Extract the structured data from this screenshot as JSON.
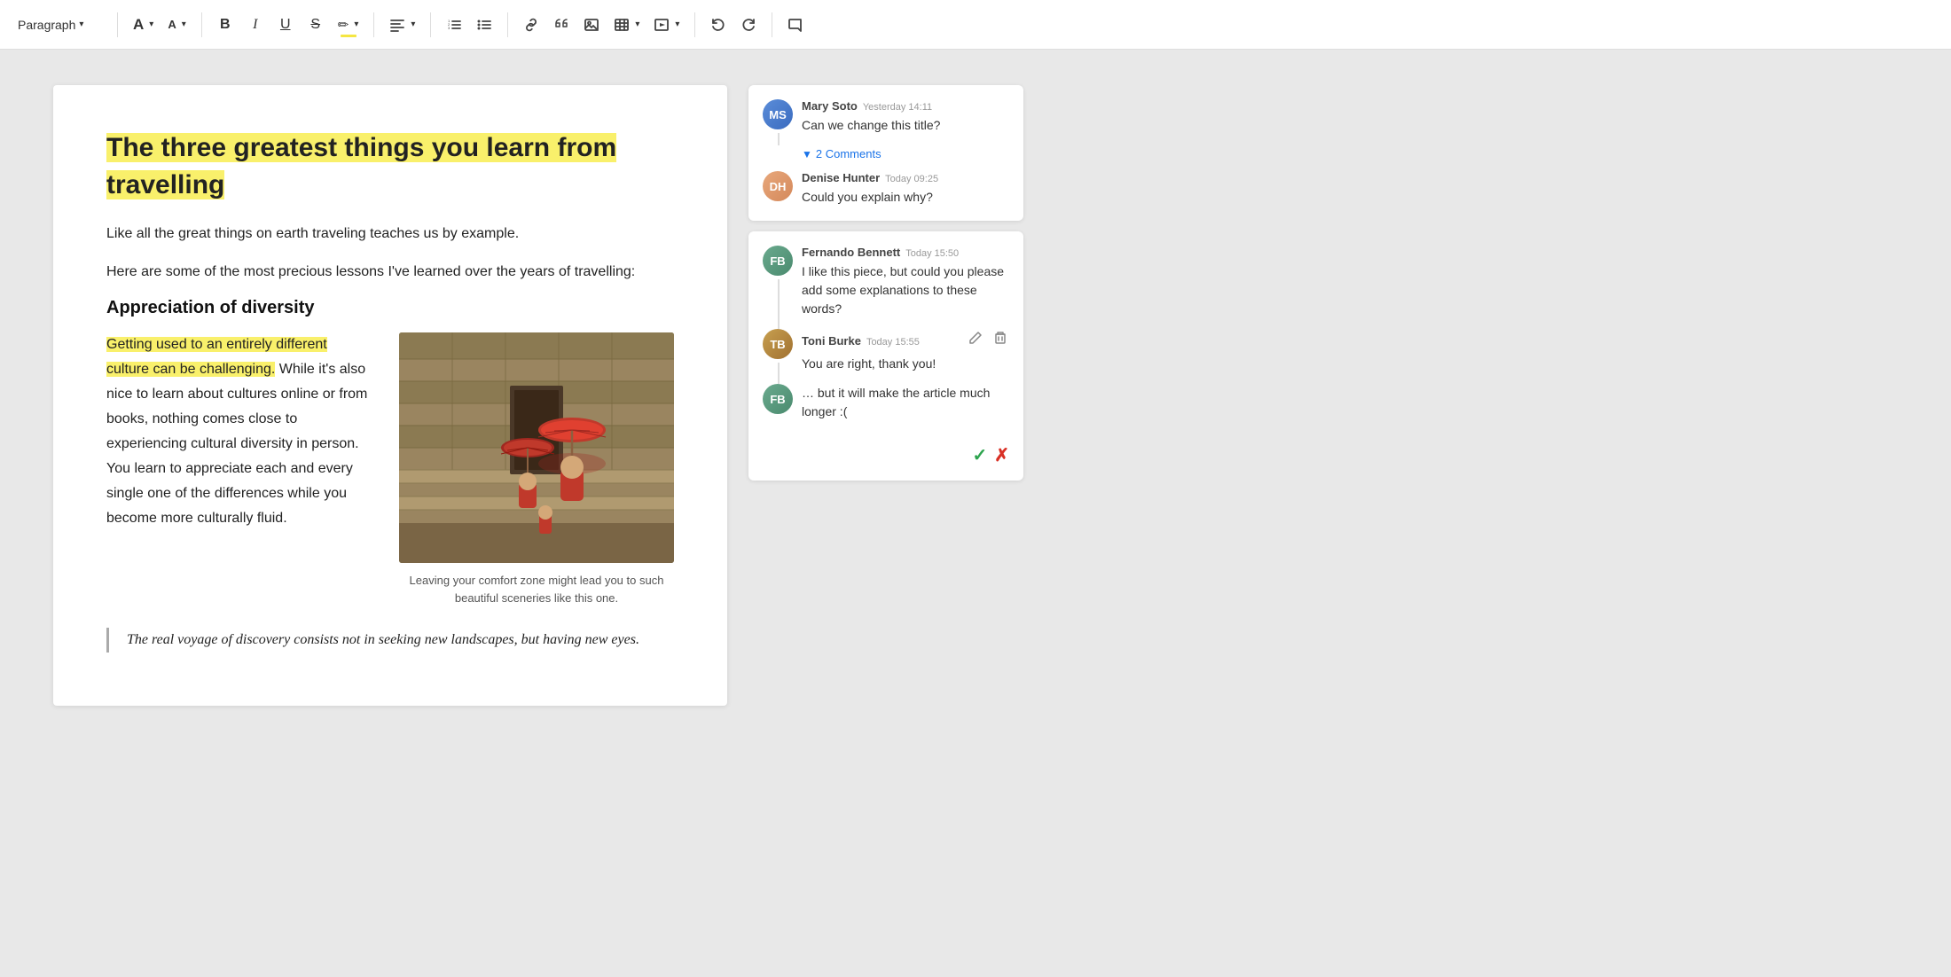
{
  "toolbar": {
    "paragraph_label": "Paragraph",
    "paragraph_chevron": "▾",
    "font_size_up": "A",
    "font_size_down": "A",
    "bold": "B",
    "italic": "I",
    "underline": "U",
    "strikethrough": "S",
    "highlight": "✏",
    "align": "≡",
    "numbered_list": "",
    "bullet_list": "",
    "link": "",
    "quote": "",
    "image": "",
    "table": "",
    "media": "",
    "undo": "",
    "redo": "",
    "comment": ""
  },
  "document": {
    "title": "The three greatest things you learn from travelling",
    "intro1": "Like all the great things on earth traveling teaches us by example.",
    "intro2": "Here are some of the most precious lessons I've learned over the years of travelling:",
    "section1_heading": "Appreciation of diversity",
    "section1_highlight": "Getting used to an entirely different culture can be challenging.",
    "section1_body": " While it's also nice to learn about cultures online or from books, nothing comes close to experiencing cultural diversity in person. You learn to appreciate each and every single one of the differences while you become more culturally fluid.",
    "image_caption": "Leaving your comfort zone might lead you to such beautiful sceneries like this one.",
    "blockquote": "The real voyage of discovery consists not in seeking new landscapes, but having new eyes."
  },
  "comments": {
    "thread1": {
      "card_id": "thread1",
      "comments": [
        {
          "id": "c1",
          "author": "Mary Soto",
          "time": "Yesterday 14:11",
          "text": "Can we change this title?",
          "avatar_label": "MS",
          "avatar_class": "avatar-mary",
          "has_line": true
        }
      ],
      "expand_label": "2 Comments"
    },
    "thread2_reply1": {
      "author": "Denise Hunter",
      "time": "Today 09:25",
      "text": "Could you explain why?",
      "avatar_label": "DH",
      "avatar_class": "avatar-denise"
    },
    "thread2": {
      "card_id": "thread2",
      "comments": [
        {
          "id": "c2",
          "author": "Fernando Bennett",
          "time": "Today 15:50",
          "text": "I like this piece, but could you please add some explanations to these words?",
          "avatar_label": "FB",
          "avatar_class": "avatar-fernando",
          "has_line": true
        },
        {
          "id": "c3",
          "author": "Toni Burke",
          "time": "Today 15:55",
          "text": "You are right, thank you!",
          "avatar_label": "TB",
          "avatar_class": "avatar-toni",
          "has_line": true,
          "has_actions": true
        },
        {
          "id": "c4",
          "author": "",
          "time": "",
          "text": "… but it will make the article much longer :(",
          "avatar_label": "FB",
          "avatar_class": "avatar-fernando",
          "has_line": false,
          "has_actions": false,
          "is_editing": true
        }
      ]
    }
  }
}
